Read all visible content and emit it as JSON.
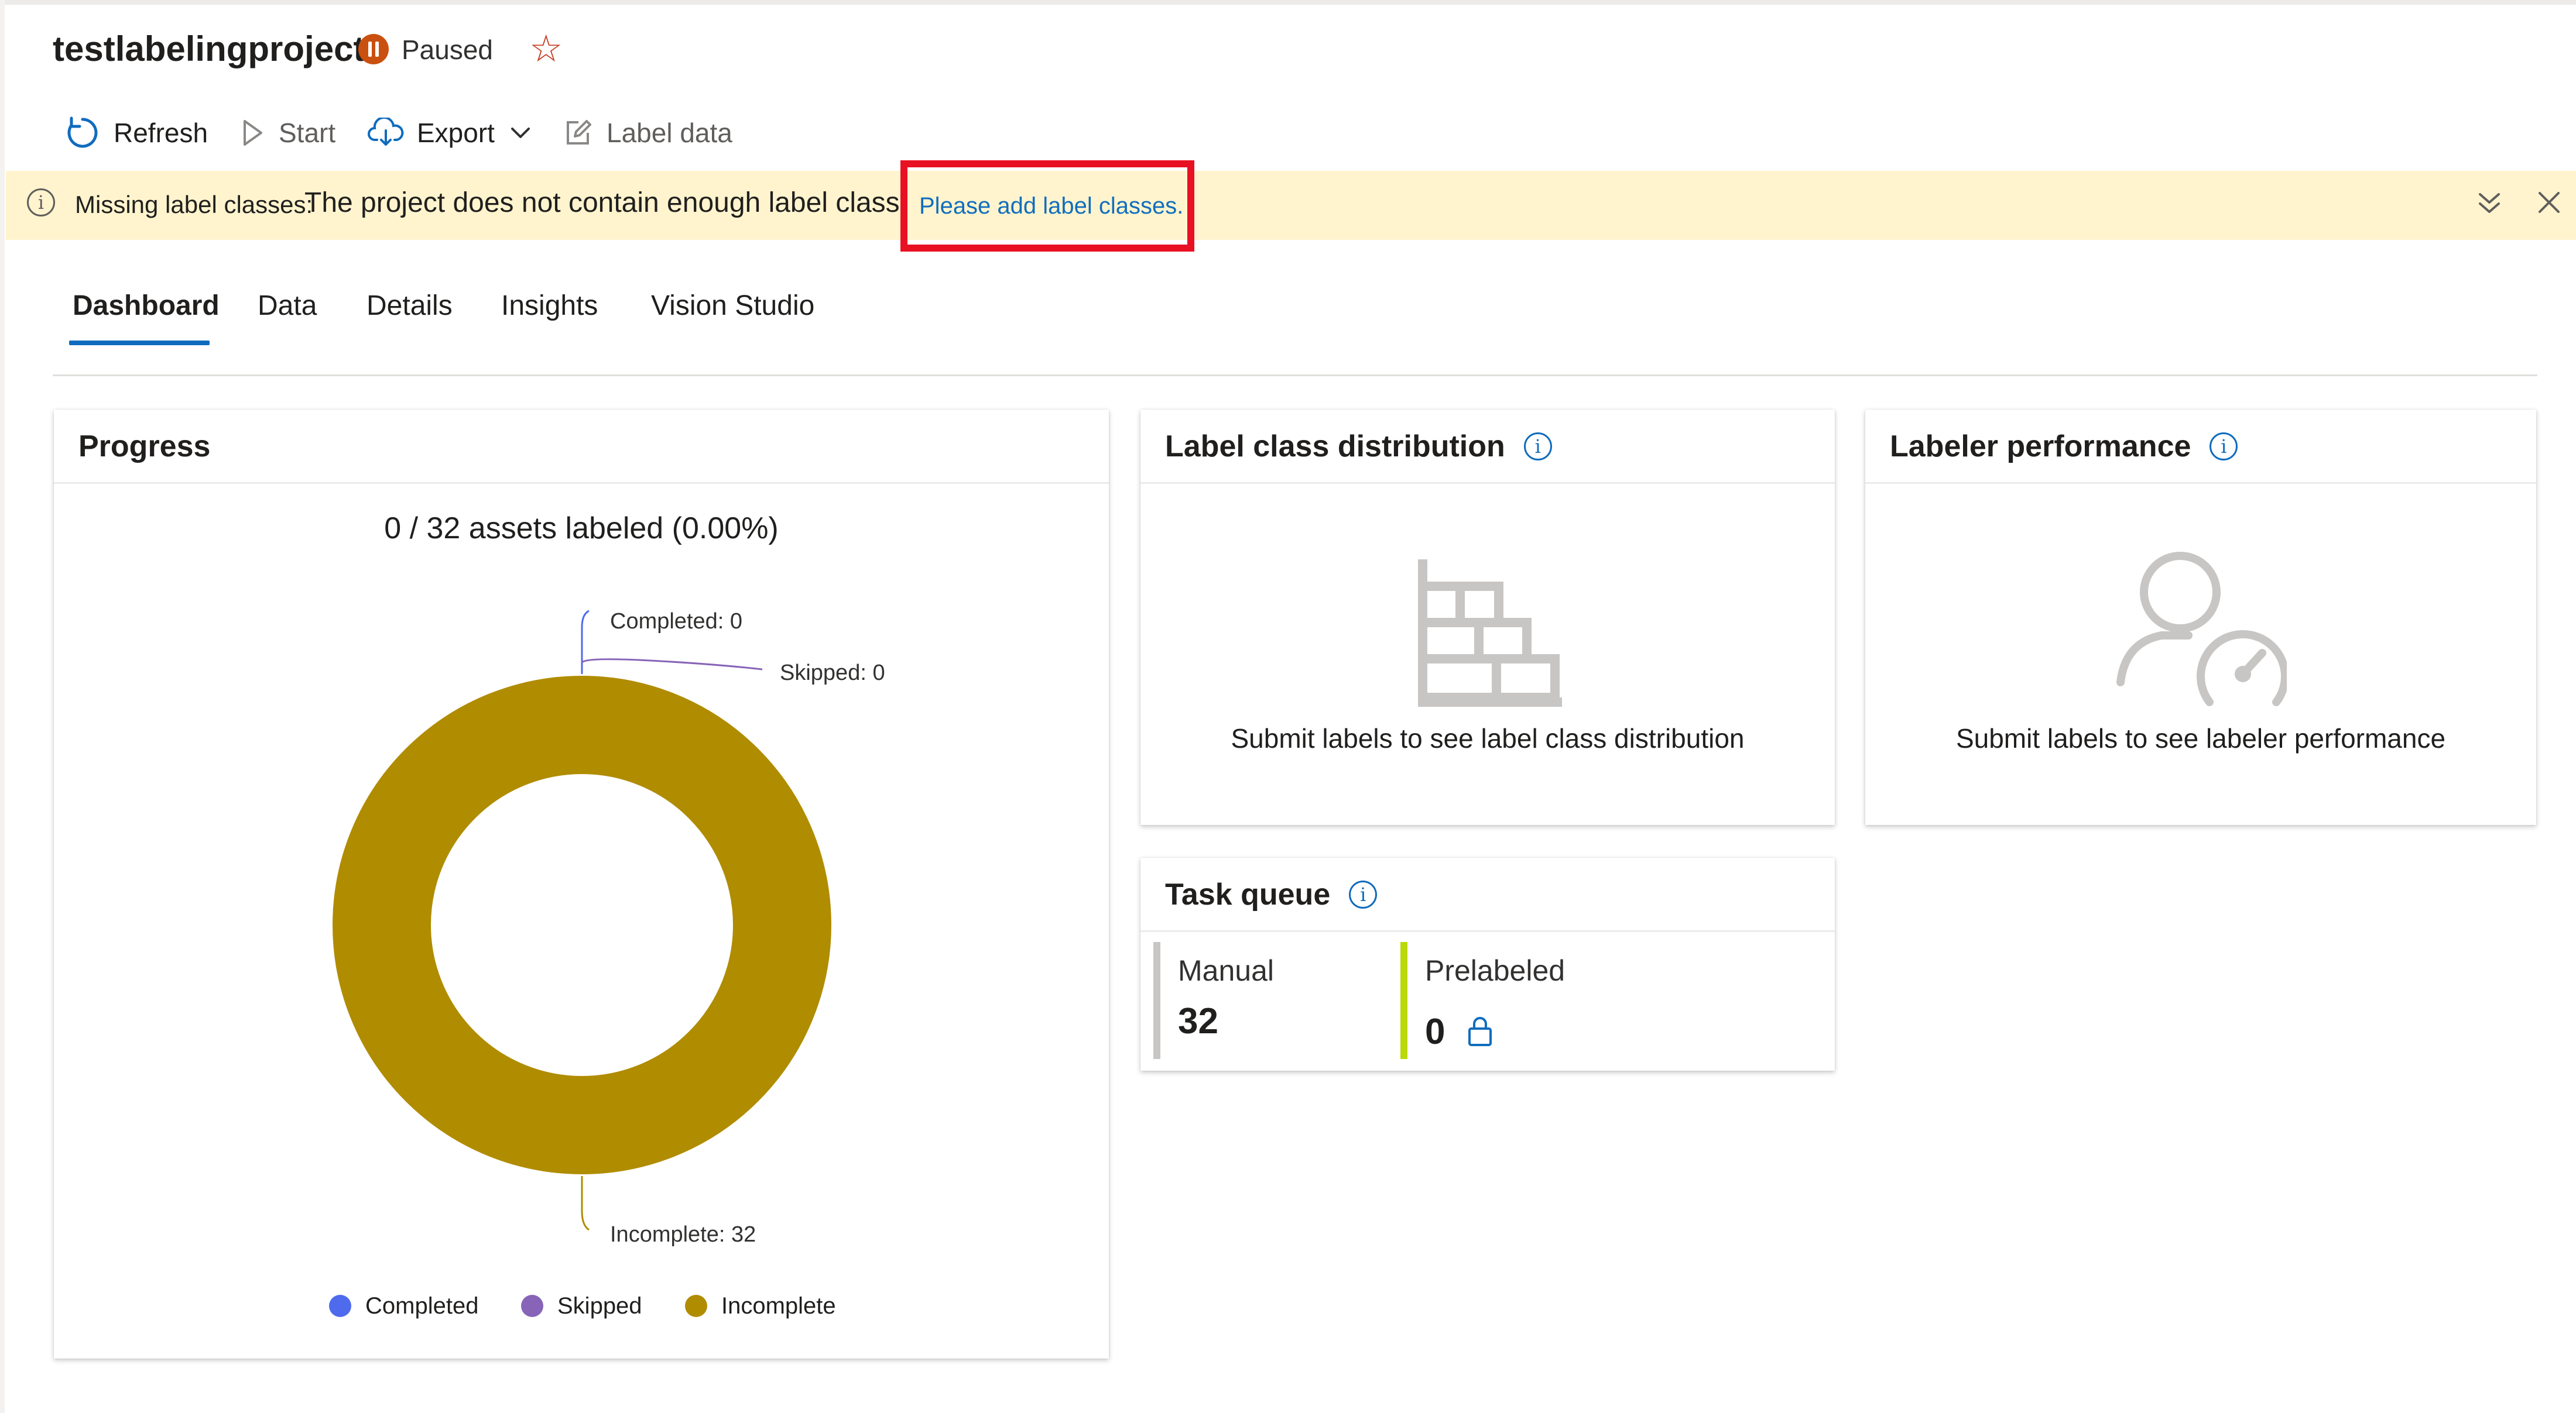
{
  "header": {
    "title": "testlabelingproject",
    "status": "Paused",
    "status_color": "#ca5010",
    "favorite_icon": "star-icon"
  },
  "toolbar": {
    "refresh": "Refresh",
    "start": "Start",
    "export": "Export",
    "label_data": "Label data"
  },
  "warning": {
    "title": "Missing label classes:",
    "body": "The project does not contain enough label classes.",
    "link": "Please add label classes.",
    "background": "#fff4ce",
    "highlight_color": "#e81123"
  },
  "tabs": [
    {
      "label": "Dashboard",
      "active": true
    },
    {
      "label": "Data"
    },
    {
      "label": "Details"
    },
    {
      "label": "Insights"
    },
    {
      "label": "Vision Studio"
    }
  ],
  "progress": {
    "title": "Progress",
    "summary": "0 / 32 assets labeled (0.00%)"
  },
  "chart_data": {
    "type": "pie",
    "style": "donut",
    "categories": [
      "Completed",
      "Skipped",
      "Incomplete"
    ],
    "values": [
      0,
      0,
      32
    ],
    "colors": [
      "#4f6bed",
      "#8764b8",
      "#b08c00"
    ],
    "data_labels": [
      "Completed: 0",
      "Skipped: 0",
      "Incomplete: 32"
    ],
    "legend": [
      "Completed",
      "Skipped",
      "Incomplete"
    ],
    "legend_position": "bottom"
  },
  "label_class_distribution": {
    "title": "Label class distribution",
    "empty_text": "Submit labels to see label class distribution"
  },
  "labeler_performance": {
    "title": "Labeler performance",
    "empty_text": "Submit labels to see labeler performance"
  },
  "task_queue": {
    "title": "Task queue",
    "manual_label": "Manual",
    "manual_value": "32",
    "manual_color": "#c8c6c4",
    "prelabeled_label": "Prelabeled",
    "prelabeled_value": "0",
    "prelabeled_color": "#bad80a"
  }
}
